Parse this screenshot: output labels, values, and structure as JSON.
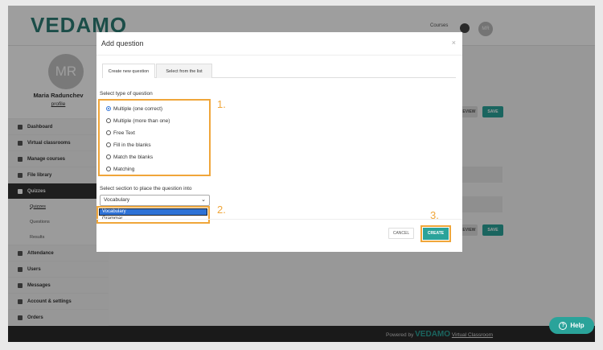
{
  "app": {
    "logo": "VEDAMO",
    "top_text": "Courses",
    "avatar_initials": "MR"
  },
  "profile": {
    "initials": "MR",
    "name": "Maria Radunchev",
    "link": "profile"
  },
  "sidebar": {
    "items": [
      {
        "label": "Dashboard",
        "icon": "grid-icon"
      },
      {
        "label": "Virtual classrooms",
        "icon": "camera-icon"
      },
      {
        "label": "Manage courses",
        "icon": "pencil-icon"
      },
      {
        "label": "File library",
        "icon": "cloud-icon"
      },
      {
        "label": "Quizzes",
        "icon": "question-icon"
      }
    ],
    "subitems": [
      "Quizzes",
      "Questions",
      "Results"
    ],
    "items_after": [
      {
        "label": "Attendance",
        "icon": "document-icon"
      },
      {
        "label": "Users",
        "icon": "users-icon"
      },
      {
        "label": "Messages",
        "icon": "envelope-icon"
      },
      {
        "label": "Account & settings",
        "icon": "gear-icon"
      },
      {
        "label": "Orders",
        "icon": "cart-icon"
      }
    ]
  },
  "background_buttons": {
    "preview": "PREVIEW",
    "save": "SAVE"
  },
  "footer": {
    "powered_by": "Powered by",
    "brand": "VEDAMO",
    "link": "Virtual Classroom"
  },
  "help": {
    "label": "Help"
  },
  "modal": {
    "title": "Add question",
    "close": "×",
    "tabs": [
      "Create new question",
      "Select from the list"
    ],
    "type_label": "Select type of question",
    "options": [
      {
        "label": "Multiple (one correct)",
        "checked": true
      },
      {
        "label": "Multiple (more than one)",
        "checked": false
      },
      {
        "label": "Free Text",
        "checked": false
      },
      {
        "label": "Fill in the blanks",
        "checked": false
      },
      {
        "label": "Match the blanks",
        "checked": false
      },
      {
        "label": "Matching",
        "checked": false
      }
    ],
    "section_label": "Select section to place the question into",
    "section_selected": "Vocabulary",
    "section_options": [
      "Vocabulary",
      "Grammar"
    ],
    "cancel": "CANCEL",
    "create": "CREATE"
  },
  "annotations": [
    "1.",
    "2.",
    "3."
  ],
  "colors": {
    "accent": "#2aa39a",
    "highlight": "#f0a63a",
    "selection": "#2e72d6"
  }
}
